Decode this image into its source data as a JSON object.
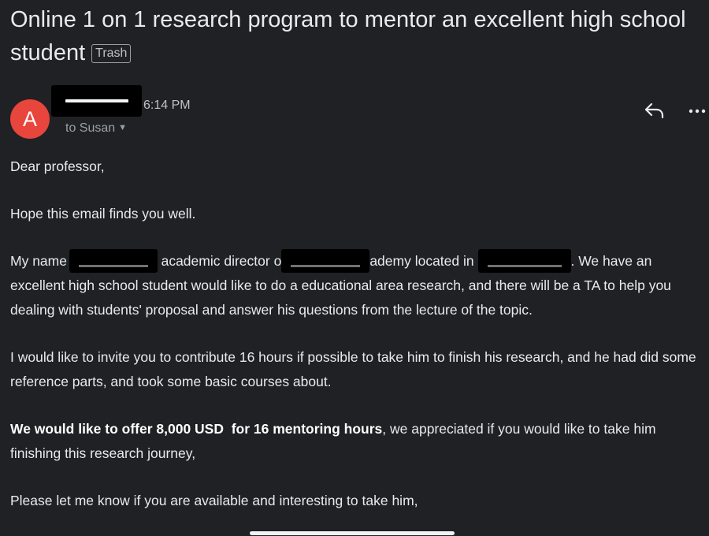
{
  "email": {
    "subject": "Online 1 on 1 research program to mentor an excellent high school student",
    "label": "Trash",
    "sender_initial": "A",
    "time": "6:14 PM",
    "recipient": "to Susan",
    "actions": {
      "reply_icon": "reply-icon",
      "more_icon": "more-options-icon"
    },
    "colors": {
      "avatar": "#e8453c",
      "background": "#202124"
    },
    "body": {
      "greeting": "Dear professor,",
      "p1": "Hope this email finds you well.",
      "p2": {
        "part_a": "My name i",
        "part_b": "academic director o",
        "part_c": "ademy located in",
        "part_d": ". We have an excellent high school student would like to do a educational area research, and there will be a TA to help you dealing with students' proposal and answer his questions from the lecture of the topic."
      },
      "p3": "I would like to invite you to contribute 16 hours if possible to take him to finish his research, and he had did some reference parts, and took some basic courses about.",
      "p4_bold": "We would like to offer 8,000 USD  for 16 mentoring hours",
      "p4_rest": ", we appreciated if you would like to take him finishing this research journey,",
      "p5": "Please let me know if you are available and interesting to take him,"
    }
  }
}
